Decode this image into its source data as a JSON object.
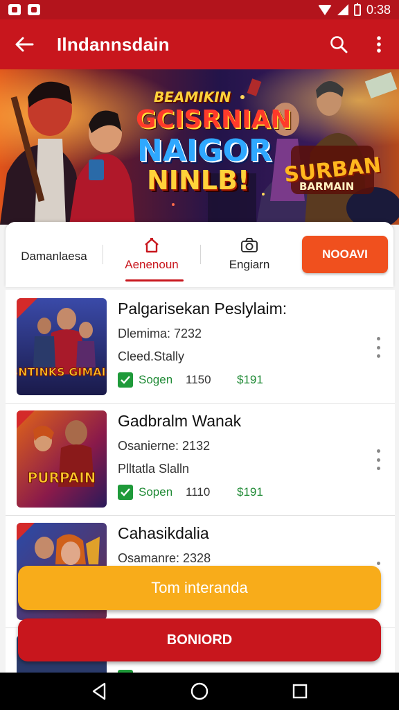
{
  "status_bar": {
    "time": "0:38"
  },
  "app_bar": {
    "title": "Ilndannsdain"
  },
  "banner": {
    "line1": "BEAMIKIN",
    "line2": "GCISRNIAN",
    "line3": "NAIGOR",
    "line4": "NINLB!",
    "badge_main": "SURBAN",
    "badge_sub": "BARMAIN"
  },
  "filters": {
    "tabs": [
      {
        "label": "Damanlaesa",
        "icon": ""
      },
      {
        "label": "Aenenoun",
        "icon": "home-icon",
        "active": true
      },
      {
        "label": "Engiarn",
        "icon": "camera-icon"
      }
    ],
    "action_label": "NOOAVI"
  },
  "items": [
    {
      "title": "Palgarisekan Peslylaim:",
      "date": "Dlemima: 7232",
      "status": "Cleed.Stally",
      "stat_label": "Sogen",
      "count": "1150",
      "price": "$191",
      "thumb_text": "BNTINKS GIMAIS"
    },
    {
      "title": "Gadbralm Wanak",
      "date": "Osanierne: 2132",
      "status": "Plltatla Slalln",
      "stat_label": "Sopen",
      "count": "1110",
      "price": "$191",
      "thumb_text": "PURPAIN"
    },
    {
      "title": "Cahasikdalia",
      "date": "Osamanre: 2328",
      "status": "",
      "stat_label": "",
      "count": "",
      "price": "",
      "thumb_text": ""
    },
    {
      "title": "",
      "date": "",
      "status": "",
      "stat_label": "",
      "count": "",
      "price": "",
      "thumb_text": ""
    }
  ],
  "buttons": {
    "primary": "Tom interanda",
    "secondary": "BONIORD"
  },
  "colors": {
    "brand_red": "#c8161d",
    "orange": "#f0501e",
    "yellow": "#f8ac1a",
    "green": "#1f8a35"
  }
}
